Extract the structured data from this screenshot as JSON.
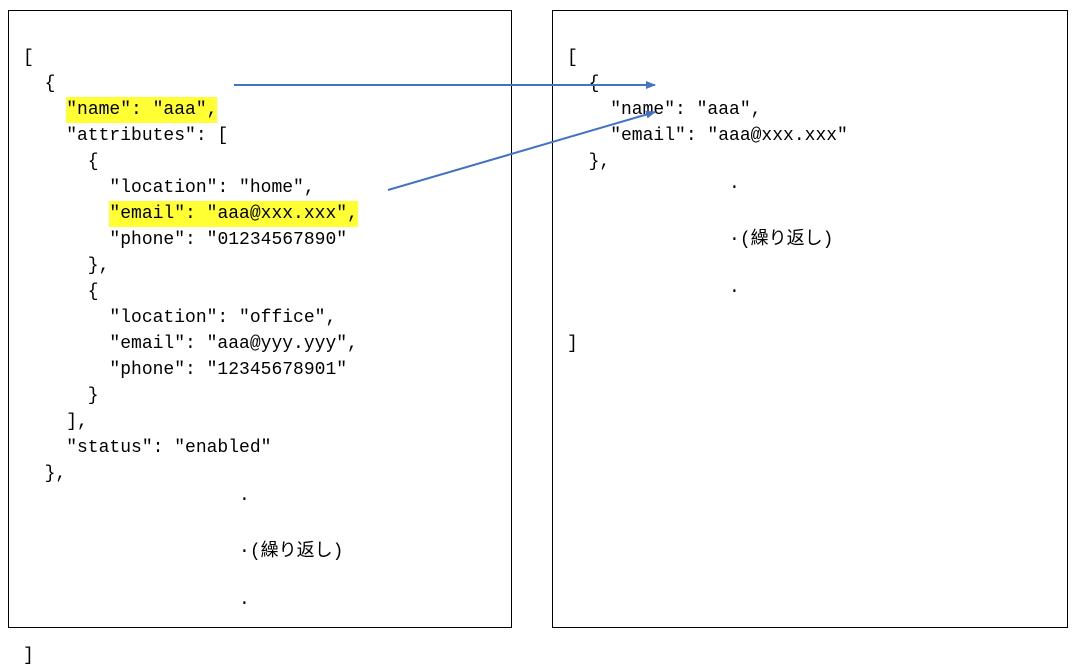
{
  "left": {
    "open_bracket": "[",
    "obj_open": "  {",
    "indent4": "    ",
    "name_kv": "\"name\": \"aaa\"",
    "comma": ",",
    "attributes_open": "    \"attributes\": [",
    "attr1_open": "      {",
    "indent8": "        ",
    "attr1_location": "\"location\": \"home\",",
    "attr1_email": "\"email\": \"aaa@xxx.xxx\"",
    "attr1_phone": "\"phone\": \"01234567890\"",
    "attr1_close": "      },",
    "attr2_open": "      {",
    "attr2_location": "        \"location\": \"office\",",
    "attr2_email": "        \"email\": \"aaa@yyy.yyy\",",
    "attr2_phone": "        \"phone\": \"12345678901\"",
    "attr2_close": "      }",
    "attributes_close": "    ],",
    "status": "    \"status\": \"enabled\"",
    "obj_close": "  },",
    "dots1": "                    ·",
    "repeat": "                    ·(繰り返し)",
    "dots2": "                    ·",
    "close_bracket": "]"
  },
  "right": {
    "open_bracket": "[",
    "obj_open": "  {",
    "name_kv": "    \"name\": \"aaa\",",
    "email_kv": "    \"email\": \"aaa@xxx.xxx\"",
    "obj_close": "  },",
    "dots1": "               ·",
    "repeat": "               ·(繰り返し)",
    "dots2": "               ·",
    "close_bracket": "]"
  },
  "arrow_color": "#4472c4"
}
